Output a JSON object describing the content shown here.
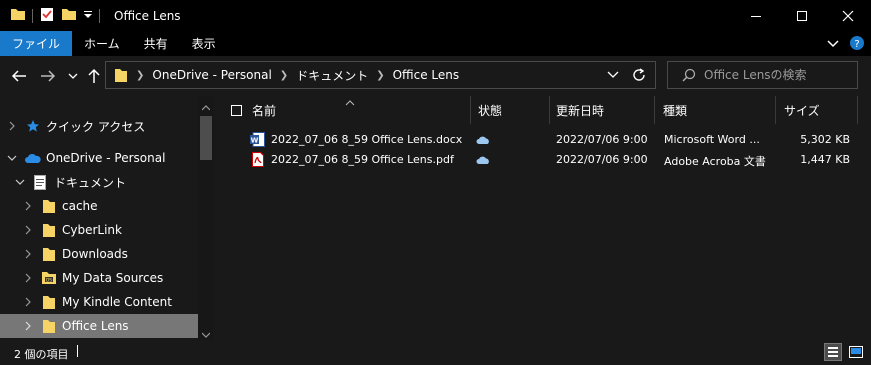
{
  "window": {
    "title": "Office Lens",
    "controls": {
      "minimize": "minimize-icon",
      "maximize": "maximize-icon",
      "close": "close-icon"
    }
  },
  "ribbon": {
    "tabs": [
      {
        "label": "ファイル",
        "active": true
      },
      {
        "label": "ホーム",
        "active": false
      },
      {
        "label": "共有",
        "active": false
      },
      {
        "label": "表示",
        "active": false
      }
    ]
  },
  "address": {
    "crumbs": [
      "OneDrive - Personal",
      "ドキュメント",
      "Office Lens"
    ]
  },
  "search": {
    "placeholder": "Office Lensの検索"
  },
  "nav": {
    "items": [
      {
        "label": "クイック アクセス",
        "icon": "star-icon",
        "indent": 0
      },
      {
        "label": "OneDrive - Personal",
        "icon": "cloud-icon",
        "indent": 0
      },
      {
        "label": "ドキュメント",
        "icon": "document-icon",
        "indent": 1
      },
      {
        "label": "cache",
        "icon": "folder-icon",
        "indent": 2
      },
      {
        "label": "CyberLink",
        "icon": "folder-icon",
        "indent": 2
      },
      {
        "label": "Downloads",
        "icon": "folder-icon",
        "indent": 2
      },
      {
        "label": "My Data Sources",
        "icon": "data-folder-icon",
        "indent": 2
      },
      {
        "label": "My Kindle Content",
        "icon": "folder-icon",
        "indent": 2
      },
      {
        "label": "Office Lens",
        "icon": "folder-icon",
        "indent": 2
      }
    ]
  },
  "columns": {
    "name": "名前",
    "status": "状態",
    "modified": "更新日時",
    "type": "種類",
    "size": "サイズ"
  },
  "files": [
    {
      "name": "2022_07_06 8_59 Office Lens.docx",
      "icon": "word-doc-icon",
      "status_icon": "cloud-status-icon",
      "modified": "2022/07/06 9:00",
      "type": "Microsoft Word ...",
      "size": "5,302 KB"
    },
    {
      "name": "2022_07_06 8_59 Office Lens.pdf",
      "icon": "pdf-icon",
      "status_icon": "cloud-status-icon",
      "modified": "2022/07/06 9:00",
      "type": "Adobe Acroba 文書",
      "size": "1,447 KB"
    }
  ],
  "status": {
    "item_count": "2 個の項目"
  },
  "colors": {
    "accent": "#1979ca",
    "background": "#191919",
    "titlebar": "#000000",
    "selection": "#777777",
    "folder": "#f6d365"
  }
}
